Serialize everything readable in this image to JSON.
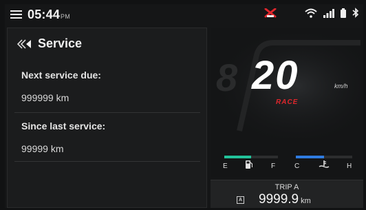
{
  "status_bar": {
    "time": "05:44",
    "ampm": "PM",
    "icons": [
      "menu-icon",
      "alert-icon",
      "wifi-icon",
      "signal-icon",
      "battery-icon",
      "bluetooth-icon"
    ],
    "alert_color": "#e0262c"
  },
  "service": {
    "title": "Service",
    "next_label": "Next service due:",
    "next_value": "999999 km",
    "since_label": "Since last service:",
    "since_value": "99999 km"
  },
  "cluster": {
    "speed": "20",
    "unit": "km/h",
    "mode": "RACE",
    "fuel": {
      "empty_label": "E",
      "full_label": "F",
      "level": 0.5,
      "color": "#22c29a"
    },
    "temp": {
      "cold_label": "C",
      "hot_label": "H",
      "level": 0.5,
      "color": "#2f7be0"
    }
  },
  "trip": {
    "label": "TRIP A",
    "icon_label": "A",
    "value": "9999.9",
    "unit": "km"
  }
}
